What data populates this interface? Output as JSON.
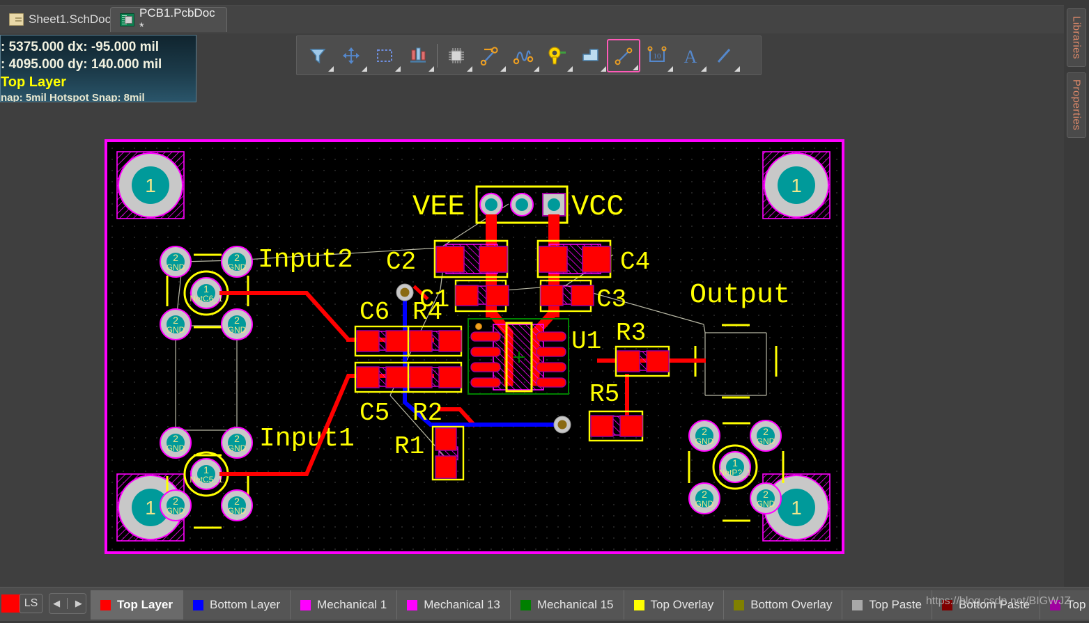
{
  "app": {
    "name": "Altium Designer PCB Editor"
  },
  "document_tabs": [
    {
      "label": "Sheet1.SchDoc",
      "icon": "schematic-icon",
      "active": false
    },
    {
      "label": "PCB1.PcbDoc *",
      "icon": "pcb-icon",
      "active": true
    }
  ],
  "hud": {
    "row1": ": 5375.000   dx:   -95.000  mil",
    "row2": ": 4095.000   dy:  140.000 mil",
    "layer": "Top Layer",
    "snap": "nap: 5mil Hotspot Snap: 8mil",
    "layer_color": "#ffff00",
    "bg_color": "#1c3b4a"
  },
  "toolbar": {
    "buttons": [
      {
        "name": "filter-icon",
        "tip": "Filter",
        "framed": false
      },
      {
        "name": "move-crosshair-icon",
        "tip": "Move",
        "framed": false
      },
      {
        "name": "selection-box-icon",
        "tip": "Selection",
        "framed": false
      },
      {
        "name": "align-icon",
        "tip": "Align",
        "framed": false
      },
      {
        "name": "place-component-icon",
        "tip": "Place Component",
        "framed": false
      },
      {
        "name": "route-track-icon",
        "tip": "Interactive Routing",
        "framed": false
      },
      {
        "name": "differential-pair-icon",
        "tip": "Differential Pair",
        "framed": false
      },
      {
        "name": "place-via-icon",
        "tip": "Place Via",
        "framed": false
      },
      {
        "name": "polygon-pour-icon",
        "tip": "Polygon Pour",
        "framed": false
      },
      {
        "name": "place-line-icon",
        "tip": "Place Line",
        "framed": true
      },
      {
        "name": "dimension-icon",
        "tip": "Dimension",
        "framed": false,
        "glyph": "10"
      },
      {
        "name": "place-string-icon",
        "tip": "Place String",
        "framed": false,
        "glyph": "A"
      },
      {
        "name": "draw-line-icon",
        "tip": "Line",
        "framed": false
      }
    ]
  },
  "right_dock": {
    "tabs": [
      {
        "label": "Libraries"
      },
      {
        "label": "Properties"
      }
    ]
  },
  "layer_bar": {
    "ls_label": "LS",
    "active_swatch": "#ff0000",
    "nav_prev": "◀",
    "nav_next": "▶",
    "layers": [
      {
        "label": "Top Layer",
        "color": "#ff0000",
        "active": true
      },
      {
        "label": "Bottom Layer",
        "color": "#0000ff",
        "active": false
      },
      {
        "label": "Mechanical 1",
        "color": "#ff00ff",
        "active": false
      },
      {
        "label": "Mechanical 13",
        "color": "#ff00ff",
        "active": false
      },
      {
        "label": "Mechanical 15",
        "color": "#008000",
        "active": false
      },
      {
        "label": "Top Overlay",
        "color": "#ffff00",
        "active": false
      },
      {
        "label": "Bottom Overlay",
        "color": "#808000",
        "active": false
      },
      {
        "label": "Top Paste",
        "color": "#a8a8a8",
        "active": false
      },
      {
        "label": "Bottom Paste",
        "color": "#800000",
        "active": false
      },
      {
        "label": "Top S",
        "color": "#a000a0",
        "active": false
      }
    ]
  },
  "watermark": "https://blog.csdn.net/BIGWJZ",
  "pcb": {
    "board_outline_color": "#ff00ff",
    "background": "#000000",
    "top_layer_color": "#ff0000",
    "bottom_layer_color": "#0000ff",
    "silkscreen_color": "#ffff00",
    "pad_ring_color": "#c8c8c8",
    "pad_hole_color": "#009a9a",
    "courtyard_color": "#008000",
    "ratsnest_color": "#c8c8b4",
    "designators": [
      "VEE",
      "VCC",
      "C1",
      "C2",
      "C3",
      "C4",
      "C5",
      "C6",
      "R1",
      "R2",
      "R3",
      "R4",
      "R5",
      "U1",
      "Input1",
      "Input2",
      "Output"
    ],
    "nets": [
      {
        "label": "NetC6_1",
        "at": "input2-connector"
      },
      {
        "label": "NetC5_1",
        "at": "input1-connector"
      },
      {
        "label": "NetP?_1",
        "at": "output-connector"
      }
    ],
    "pad_labels": {
      "gnd": "GND",
      "gnd_number": "2",
      "signal_number": "1",
      "mount_number": "1"
    },
    "mounting_holes": 4
  }
}
